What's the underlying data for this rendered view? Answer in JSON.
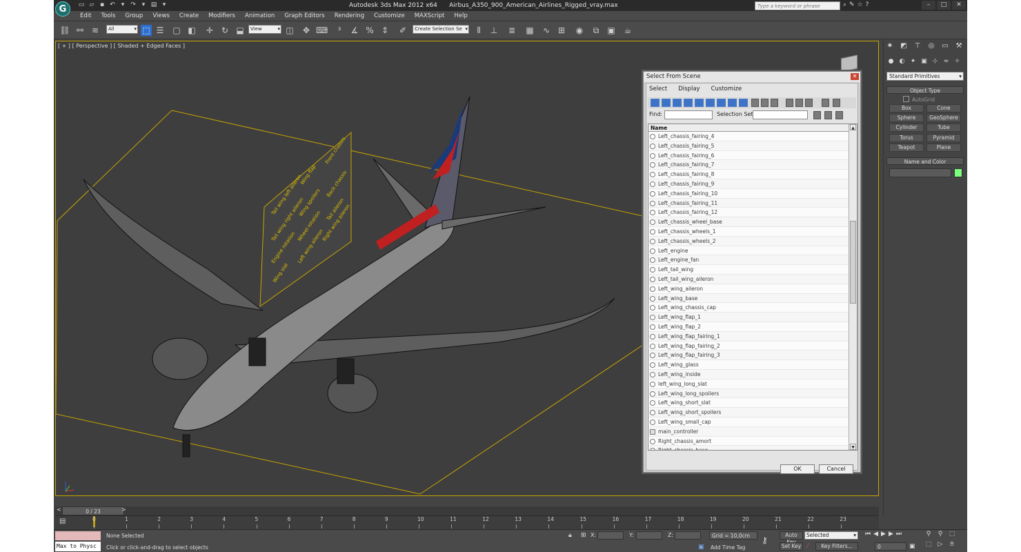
{
  "window": {
    "app_title": "Autodesk 3ds Max  2012 x64",
    "file_title": "Airbus_A350_900_American_Airlines_Rigged_vray.max",
    "search_placeholder": "Type a keyword or phrase"
  },
  "menu": [
    "Edit",
    "Tools",
    "Group",
    "Views",
    "Create",
    "Modifiers",
    "Animation",
    "Graph Editors",
    "Rendering",
    "Customize",
    "MAXScript",
    "Help"
  ],
  "toolbar": {
    "filter_value": "All",
    "refcoord_value": "View",
    "named_selection_placeholder": "Create Selection Se"
  },
  "viewport": {
    "label": "[ + ] [ Perspective ] [ Shaded + Edged Faces ]",
    "control_labels": [
      "Tail wing left aileron",
      "Tail wing right aileron",
      "Engine rotation",
      "Wing flap",
      "Wing spoilers",
      "Wheel rotation",
      "Left wing aileron",
      "Front chassis",
      "Back chassis",
      "Tail aileron",
      "Right wing aileron",
      "Wing slat"
    ]
  },
  "dialog": {
    "title": "Select From Scene",
    "menu": [
      "Select",
      "Display",
      "Customize"
    ],
    "find_label": "Find:",
    "selection_set_label": "Selection Set:",
    "column_header": "Name",
    "items": [
      "Left_chassis_fairing_4",
      "Left_chassis_fairing_5",
      "Left_chassis_fairing_6",
      "Left_chassis_fairing_7",
      "Left_chassis_fairing_8",
      "Left_chassis_fairing_9",
      "Left_chassis_fairing_10",
      "Left_chassis_fairing_11",
      "Left_chassis_fairing_12",
      "Left_chassis_wheel_base",
      "Left_chassis_wheels_1",
      "Left_chassis_wheels_2",
      "Left_engine",
      "Left_engine_fan",
      "Left_tail_wing",
      "Left_tail_wing_aileron",
      "Left_wing_aileron",
      "Left_wing_base",
      "Left_wing_chassis_cap",
      "Left_wing_flap_1",
      "Left_wing_flap_2",
      "Left_wing_flap_fairing_1",
      "Left_wing_flap_fairing_2",
      "Left_wing_flap_fairing_3",
      "Left_wing_glass",
      "Left_wing_inside",
      "left_wing_long_slat",
      "Left_wing_long_spoilers",
      "Left_wing_short_slat",
      "Left_wing_short_spoilers",
      "Left_wing_small_cap",
      "main_controller",
      "Right_chassis_amort",
      "Right_chassis_base"
    ],
    "ok_label": "OK",
    "cancel_label": "Cancel"
  },
  "command_panel": {
    "category_dropdown": "Standard Primitives",
    "object_type_header": "Object Type",
    "autogrid_label": "AutoGrid",
    "primitives": [
      "Box",
      "Cone",
      "Sphere",
      "GeoSphere",
      "Cylinder",
      "Tube",
      "Torus",
      "Pyramid",
      "Teapot",
      "Plane"
    ],
    "name_color_header": "Name and Color",
    "swatch_color": "#7cff7c"
  },
  "timeline": {
    "frame_display": "0 / 23",
    "ticks": [
      "0",
      "1",
      "2",
      "3",
      "4",
      "5",
      "6",
      "7",
      "8",
      "9",
      "10",
      "11",
      "12",
      "13",
      "14",
      "15",
      "16",
      "17",
      "18",
      "19",
      "20",
      "21",
      "22",
      "23"
    ]
  },
  "status": {
    "maxscript_label": "Max to Physc",
    "selection_status": "None Selected",
    "prompt": "Click or click-and-drag to select objects",
    "x_label": "X:",
    "y_label": "Y:",
    "z_label": "Z:",
    "grid": "Grid = 10,0cm",
    "add_time_tag": "Add Time Tag",
    "auto_key": "Auto Key",
    "set_key": "Set Key",
    "selected_dropdown": "Selected",
    "key_filters": "Key Filters...",
    "frame_value": "0"
  }
}
